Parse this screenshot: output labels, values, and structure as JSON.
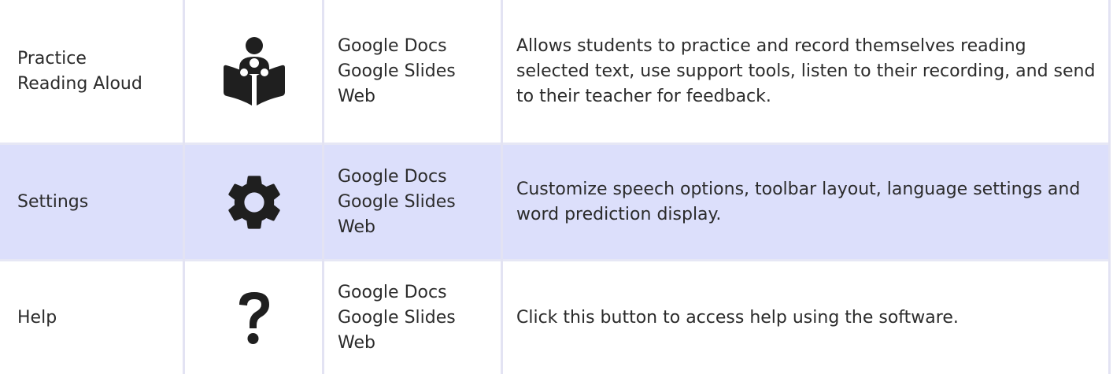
{
  "rows": [
    {
      "name": "Practice\nReading Aloud",
      "name_lines": [
        "Practice",
        "Reading Aloud"
      ],
      "icon": "reading-person-icon",
      "platforms": [
        "Google Docs",
        "Google Slides",
        "Web"
      ],
      "description": "Allows students to practice and record themselves reading selected text, use support tools, listen to their recording, and send to their teacher for feedback."
    },
    {
      "name": "Settings",
      "icon": "gear-icon",
      "platforms": [
        "Google Docs",
        "Google Slides",
        "Web"
      ],
      "description": "Customize speech options, toolbar layout, language settings and word prediction display."
    },
    {
      "name": "Help",
      "icon": "question-mark-icon",
      "platforms": [
        "Google Docs",
        "Google Slides",
        "Web"
      ],
      "description": "Click this button to access help using the software."
    }
  ],
  "colors": {
    "highlight_row": "#dcdffb",
    "grid_line": "#e3e3f3",
    "icon": "#1f1f1f",
    "text": "#2b2b2b"
  }
}
